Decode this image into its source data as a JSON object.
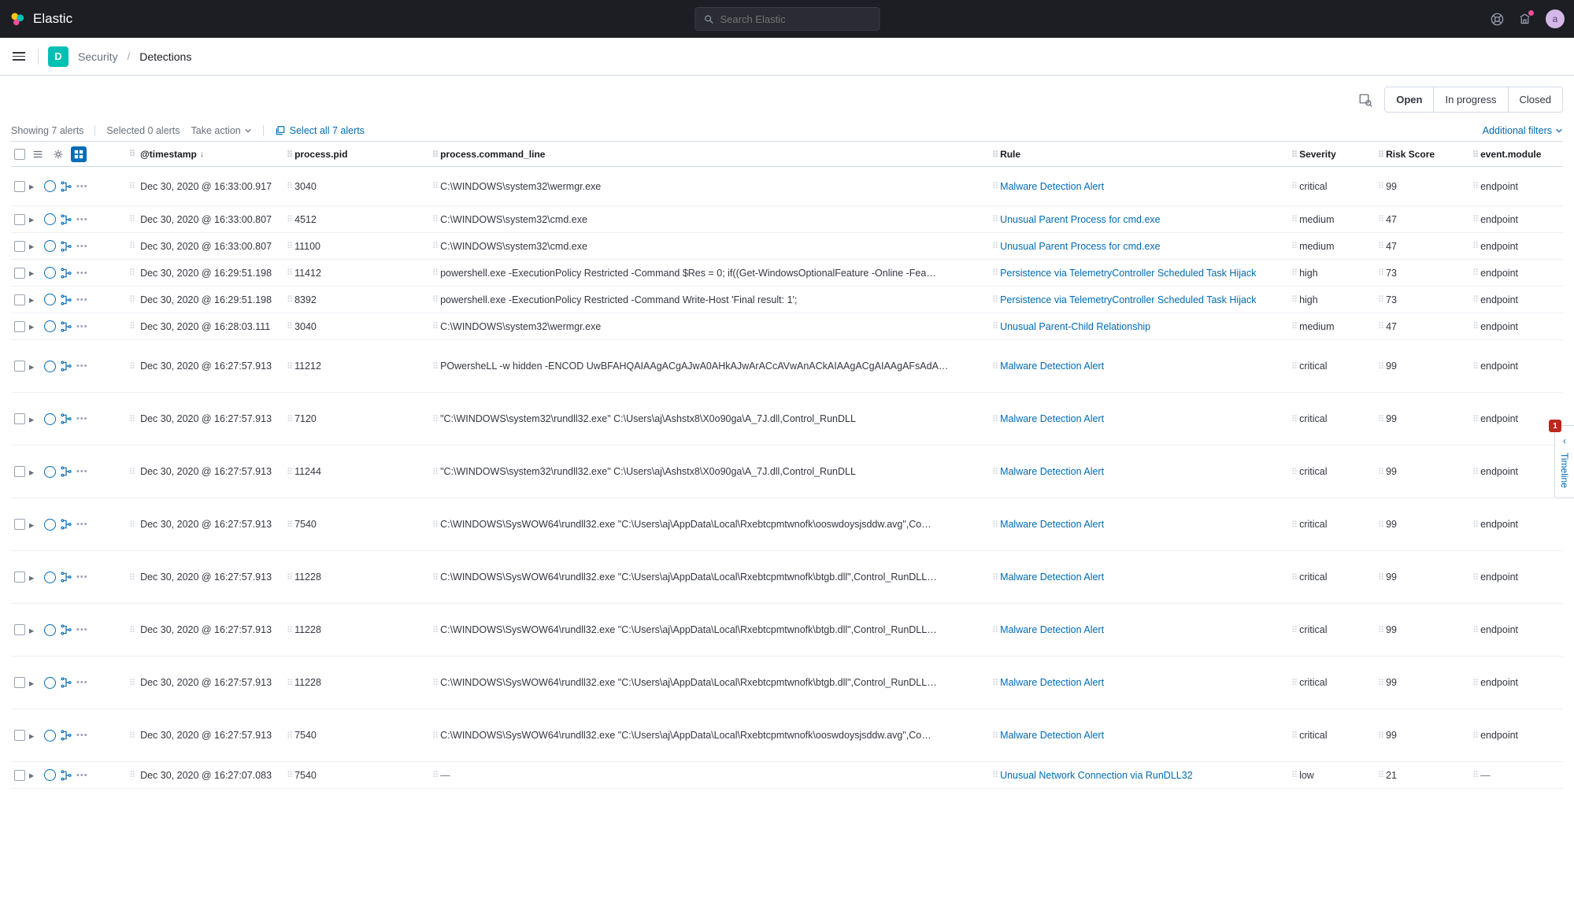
{
  "brand": "Elastic",
  "search_placeholder": "Search Elastic",
  "avatar_initial": "a",
  "space_initial": "D",
  "breadcrumb": {
    "parent": "Security",
    "current": "Detections"
  },
  "status_filters": {
    "open": "Open",
    "in_progress": "In progress",
    "closed": "Closed"
  },
  "meta": {
    "showing": "Showing 7 alerts",
    "selected": "Selected 0 alerts",
    "take_action": "Take action",
    "select_all": "Select all 7 alerts",
    "additional_filters": "Additional filters"
  },
  "columns": {
    "timestamp": "@timestamp",
    "pid": "process.pid",
    "cmd": "process.command_line",
    "rule": "Rule",
    "severity": "Severity",
    "risk": "Risk Score",
    "module": "event.module"
  },
  "timeline": {
    "label": "Timeline",
    "badge": "1"
  },
  "rows": [
    {
      "ts": "Dec 30, 2020 @ 16:33:00.917",
      "pid": "3040",
      "cmd": "C:\\WINDOWS\\system32\\wermgr.exe",
      "rule": "Malware Detection Alert",
      "sev": "critical",
      "risk": "99",
      "mod": "endpoint",
      "size": "first"
    },
    {
      "ts": "Dec 30, 2020 @ 16:33:00.807",
      "pid": "4512",
      "cmd": "C:\\WINDOWS\\system32\\cmd.exe",
      "rule": "Unusual Parent Process for cmd.exe",
      "sev": "medium",
      "risk": "47",
      "mod": "endpoint",
      "size": "small"
    },
    {
      "ts": "Dec 30, 2020 @ 16:33:00.807",
      "pid": "11100",
      "cmd": "C:\\WINDOWS\\system32\\cmd.exe",
      "rule": "Unusual Parent Process for cmd.exe",
      "sev": "medium",
      "risk": "47",
      "mod": "endpoint",
      "size": "small"
    },
    {
      "ts": "Dec 30, 2020 @ 16:29:51.198",
      "pid": "11412",
      "cmd": "powershell.exe -ExecutionPolicy Restricted -Command $Res = 0; if((Get-WindowsOptionalFeature -Online -Fea…",
      "rule": "Persistence via TelemetryController Scheduled Task Hijack",
      "sev": "high",
      "risk": "73",
      "mod": "endpoint",
      "size": "small"
    },
    {
      "ts": "Dec 30, 2020 @ 16:29:51.198",
      "pid": "8392",
      "cmd": "powershell.exe -ExecutionPolicy Restricted -Command Write-Host 'Final result: 1';",
      "rule": "Persistence via TelemetryController Scheduled Task Hijack",
      "sev": "high",
      "risk": "73",
      "mod": "endpoint",
      "size": "small"
    },
    {
      "ts": "Dec 30, 2020 @ 16:28:03.111",
      "pid": "3040",
      "cmd": "C:\\WINDOWS\\system32\\wermgr.exe",
      "rule": "Unusual Parent-Child Relationship",
      "sev": "medium",
      "risk": "47",
      "mod": "endpoint",
      "size": "small"
    },
    {
      "ts": "Dec 30, 2020 @ 16:27:57.913",
      "pid": "11212",
      "cmd": "POwersheLL -w hidden -ENCOD UwBFAHQAIAAgACgAJwA0AHkAJwArACcAVwAnACkAIAAgACgAIAAgAFsAdA…",
      "rule": "Malware Detection Alert",
      "sev": "critical",
      "risk": "99",
      "mod": "endpoint",
      "size": "big"
    },
    {
      "ts": "Dec 30, 2020 @ 16:27:57.913",
      "pid": "7120",
      "cmd": "\"C:\\WINDOWS\\system32\\rundll32.exe\" C:\\Users\\aj\\Ashstx8\\X0o90ga\\A_7J.dll,Control_RunDLL",
      "rule": "Malware Detection Alert",
      "sev": "critical",
      "risk": "99",
      "mod": "endpoint",
      "size": "big"
    },
    {
      "ts": "Dec 30, 2020 @ 16:27:57.913",
      "pid": "11244",
      "cmd": "\"C:\\WINDOWS\\system32\\rundll32.exe\" C:\\Users\\aj\\Ashstx8\\X0o90ga\\A_7J.dll,Control_RunDLL",
      "rule": "Malware Detection Alert",
      "sev": "critical",
      "risk": "99",
      "mod": "endpoint",
      "size": "big"
    },
    {
      "ts": "Dec 30, 2020 @ 16:27:57.913",
      "pid": "7540",
      "cmd": "C:\\WINDOWS\\SysWOW64\\rundll32.exe \"C:\\Users\\aj\\AppData\\Local\\Rxebtcpmtwnofk\\ooswdoysjsddw.avg\",Co…",
      "rule": "Malware Detection Alert",
      "sev": "critical",
      "risk": "99",
      "mod": "endpoint",
      "size": "big"
    },
    {
      "ts": "Dec 30, 2020 @ 16:27:57.913",
      "pid": "11228",
      "cmd": "C:\\WINDOWS\\SysWOW64\\rundll32.exe \"C:\\Users\\aj\\AppData\\Local\\Rxebtcpmtwnofk\\btgb.dll\",Control_RunDLL…",
      "rule": "Malware Detection Alert",
      "sev": "critical",
      "risk": "99",
      "mod": "endpoint",
      "size": "big"
    },
    {
      "ts": "Dec 30, 2020 @ 16:27:57.913",
      "pid": "11228",
      "cmd": "C:\\WINDOWS\\SysWOW64\\rundll32.exe \"C:\\Users\\aj\\AppData\\Local\\Rxebtcpmtwnofk\\btgb.dll\",Control_RunDLL…",
      "rule": "Malware Detection Alert",
      "sev": "critical",
      "risk": "99",
      "mod": "endpoint",
      "size": "big"
    },
    {
      "ts": "Dec 30, 2020 @ 16:27:57.913",
      "pid": "11228",
      "cmd": "C:\\WINDOWS\\SysWOW64\\rundll32.exe \"C:\\Users\\aj\\AppData\\Local\\Rxebtcpmtwnofk\\btgb.dll\",Control_RunDLL…",
      "rule": "Malware Detection Alert",
      "sev": "critical",
      "risk": "99",
      "mod": "endpoint",
      "size": "big"
    },
    {
      "ts": "Dec 30, 2020 @ 16:27:57.913",
      "pid": "7540",
      "cmd": "C:\\WINDOWS\\SysWOW64\\rundll32.exe \"C:\\Users\\aj\\AppData\\Local\\Rxebtcpmtwnofk\\ooswdoysjsddw.avg\",Co…",
      "rule": "Malware Detection Alert",
      "sev": "critical",
      "risk": "99",
      "mod": "endpoint",
      "size": "big"
    },
    {
      "ts": "Dec 30, 2020 @ 16:27:07.083",
      "pid": "7540",
      "cmd": "—",
      "rule": "Unusual Network Connection via RunDLL32",
      "sev": "low",
      "risk": "21",
      "mod": "—",
      "size": "small"
    }
  ]
}
